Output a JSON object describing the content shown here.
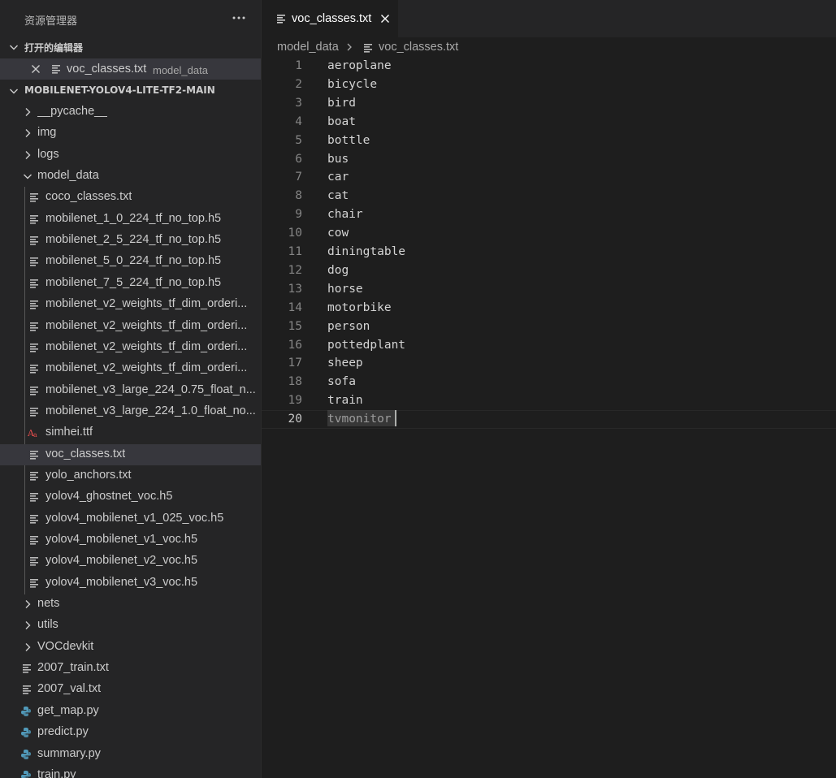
{
  "sidebar": {
    "title": "资源管理器",
    "more_icon": "ellipsis-icon",
    "open_editors": {
      "header": "打开的编辑器",
      "items": [
        {
          "name": "voc_classes.txt",
          "description": "model_data"
        }
      ]
    },
    "workspace": {
      "header": "MOBILENET-YOLOV4-LITE-TF2-MAIN",
      "items": [
        {
          "name": "__pycache__",
          "kind": "folder",
          "expanded": false
        },
        {
          "name": "img",
          "kind": "folder",
          "expanded": false
        },
        {
          "name": "logs",
          "kind": "folder",
          "expanded": false
        },
        {
          "name": "model_data",
          "kind": "folder",
          "expanded": true
        },
        {
          "name": "coco_classes.txt",
          "kind": "file"
        },
        {
          "name": "mobilenet_1_0_224_tf_no_top.h5",
          "kind": "file"
        },
        {
          "name": "mobilenet_2_5_224_tf_no_top.h5",
          "kind": "file"
        },
        {
          "name": "mobilenet_5_0_224_tf_no_top.h5",
          "kind": "file"
        },
        {
          "name": "mobilenet_7_5_224_tf_no_top.h5",
          "kind": "file"
        },
        {
          "name": "mobilenet_v2_weights_tf_dim_orderi...",
          "kind": "file"
        },
        {
          "name": "mobilenet_v2_weights_tf_dim_orderi...",
          "kind": "file"
        },
        {
          "name": "mobilenet_v2_weights_tf_dim_orderi...",
          "kind": "file"
        },
        {
          "name": "mobilenet_v2_weights_tf_dim_orderi...",
          "kind": "file"
        },
        {
          "name": "mobilenet_v3_large_224_0.75_float_n...",
          "kind": "file"
        },
        {
          "name": "mobilenet_v3_large_224_1.0_float_no...",
          "kind": "file"
        },
        {
          "name": "simhei.ttf",
          "kind": "font"
        },
        {
          "name": "voc_classes.txt",
          "kind": "file",
          "selected": true
        },
        {
          "name": "yolo_anchors.txt",
          "kind": "file"
        },
        {
          "name": "yolov4_ghostnet_voc.h5",
          "kind": "file"
        },
        {
          "name": "yolov4_mobilenet_v1_025_voc.h5",
          "kind": "file"
        },
        {
          "name": "yolov4_mobilenet_v1_voc.h5",
          "kind": "file"
        },
        {
          "name": "yolov4_mobilenet_v2_voc.h5",
          "kind": "file"
        },
        {
          "name": "yolov4_mobilenet_v3_voc.h5",
          "kind": "file"
        },
        {
          "name": "nets",
          "kind": "folder",
          "expanded": false
        },
        {
          "name": "utils",
          "kind": "folder",
          "expanded": false
        },
        {
          "name": "VOCdevkit",
          "kind": "folder",
          "expanded": false
        },
        {
          "name": "2007_train.txt",
          "kind": "file"
        },
        {
          "name": "2007_val.txt",
          "kind": "file"
        },
        {
          "name": "get_map.py",
          "kind": "python"
        },
        {
          "name": "predict.py",
          "kind": "python"
        },
        {
          "name": "summary.py",
          "kind": "python"
        },
        {
          "name": "train.py",
          "kind": "python"
        }
      ]
    }
  },
  "editor": {
    "tab": {
      "label": "voc_classes.txt",
      "close_icon": "close-icon"
    },
    "breadcrumb": [
      "model_data",
      "voc_classes.txt"
    ],
    "current_line": 20,
    "lines": [
      "aeroplane",
      "bicycle",
      "bird",
      "boat",
      "bottle",
      "bus",
      "car",
      "cat",
      "chair",
      "cow",
      "diningtable",
      "dog",
      "horse",
      "motorbike",
      "person",
      "pottedplant",
      "sheep",
      "sofa",
      "train",
      "tvmonitor"
    ]
  },
  "colors": {
    "sidebar_bg": "#252526",
    "editor_bg": "#1e1e1e",
    "selection_bg": "#37373d",
    "python_icon": "#519aba",
    "font_icon": "#e44d4d"
  }
}
